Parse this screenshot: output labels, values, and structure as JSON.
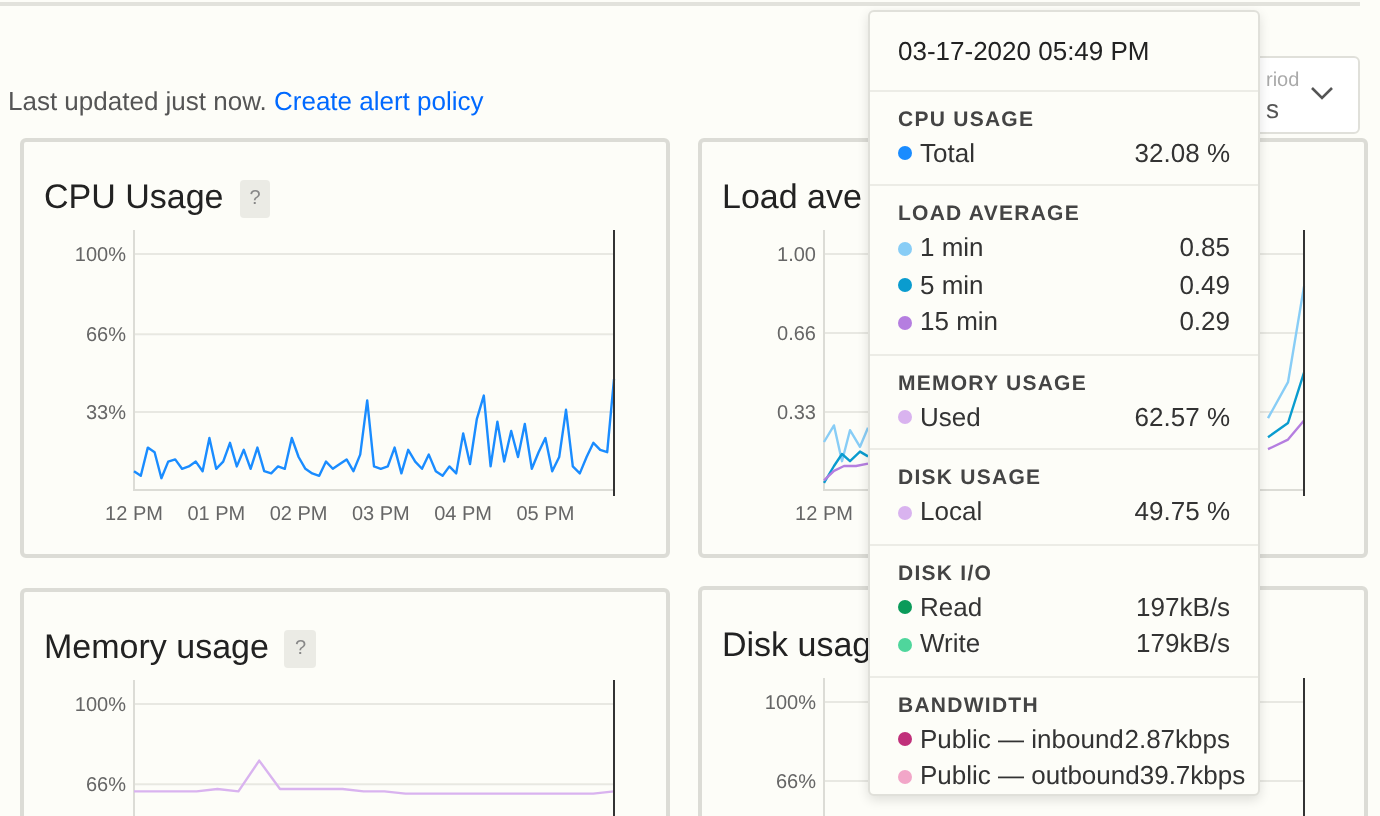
{
  "status": {
    "text": "Last updated just now.",
    "link": "Create alert policy"
  },
  "period_selector": {
    "label": "riod",
    "value": "s"
  },
  "cards": [
    {
      "title": "CPU Usage",
      "help": "?",
      "chart_data": {
        "type": "line",
        "ylim": [
          0,
          100
        ],
        "yticks": [
          {
            "value": 100,
            "label": "100%"
          },
          {
            "value": 66,
            "label": "66%"
          },
          {
            "value": 33,
            "label": "33%"
          }
        ],
        "categories": [
          "12 PM",
          null,
          null,
          null,
          null,
          null,
          null,
          null,
          null,
          null,
          null,
          null,
          "01 PM",
          null,
          null,
          null,
          null,
          null,
          null,
          null,
          null,
          null,
          null,
          null,
          "02 PM",
          null,
          null,
          null,
          null,
          null,
          null,
          null,
          null,
          null,
          null,
          null,
          "03 PM",
          null,
          null,
          null,
          null,
          null,
          null,
          null,
          null,
          null,
          null,
          null,
          "04 PM",
          null,
          null,
          null,
          null,
          null,
          null,
          null,
          null,
          null,
          null,
          null,
          "05 PM",
          null,
          null,
          null,
          null,
          null,
          null,
          null,
          null,
          null,
          null
        ],
        "series": [
          {
            "color": "#1a8cff",
            "values": [
              8,
              6,
              18,
              16,
              5,
              12,
              13,
              9,
              10,
              12,
              8,
              22,
              9,
              12,
              20,
              10,
              17,
              9,
              18,
              8,
              7,
              10,
              9,
              22,
              14,
              9,
              7,
              6,
              12,
              9,
              11,
              13,
              8,
              15,
              38,
              10,
              9,
              10,
              18,
              7,
              17,
              12,
              9,
              15,
              8,
              6,
              10,
              7,
              24,
              11,
              30,
              40,
              10,
              29,
              12,
              25,
              14,
              28,
              9,
              16,
              22,
              8,
              14,
              34,
              10,
              7,
              14,
              20,
              17,
              16,
              47
            ]
          }
        ]
      }
    },
    {
      "title": "Load ave",
      "axis": {
        "y_labels": [
          "1.00",
          "0.66",
          "0.33"
        ],
        "x_labels": [
          "12 PM"
        ],
        "kind": "load"
      }
    },
    {
      "title": "Memory usage",
      "help": "?",
      "chart_data": {
        "type": "line",
        "ylim": [
          0,
          100
        ],
        "yticks": [
          {
            "value": 100,
            "label": "100%"
          },
          {
            "value": 66,
            "label": "66%"
          }
        ],
        "categories": [
          null,
          null,
          null,
          null,
          null,
          null,
          null,
          null,
          null,
          null,
          null,
          null,
          null,
          null,
          null,
          null,
          null,
          null,
          null,
          null,
          null,
          null,
          null,
          null
        ],
        "series": [
          {
            "color": "#d9b3ef",
            "values": [
              63,
              63,
              63,
              63,
              64,
              63,
              76,
              64,
              64,
              64,
              64,
              63,
              63,
              62,
              62,
              62,
              62,
              62,
              62,
              62,
              62,
              62,
              62,
              63
            ]
          }
        ]
      }
    },
    {
      "title": "Disk usag",
      "axis": {
        "y_labels": [
          "100%",
          "66%"
        ],
        "kind": "empty"
      }
    }
  ],
  "tooltip": {
    "title": "03-17-2020 05:49 PM",
    "sections": [
      {
        "heading": "CPU USAGE",
        "rows": [
          {
            "label": "Total",
            "value": "32.08 %",
            "color": "#1a8cff"
          }
        ]
      },
      {
        "heading": "LOAD AVERAGE",
        "rows": [
          {
            "label": "1 min",
            "value": "0.85",
            "color": "#88cdf6"
          },
          {
            "label": "5 min",
            "value": "0.49",
            "color": "#0a9ccf"
          },
          {
            "label": "15 min",
            "value": "0.29",
            "color": "#b57ee0"
          }
        ]
      },
      {
        "heading": "MEMORY USAGE",
        "rows": [
          {
            "label": "Used",
            "value": "62.57 %",
            "color": "#d9b3ef"
          }
        ]
      },
      {
        "heading": "DISK USAGE",
        "rows": [
          {
            "label": "Local",
            "value": "49.75 %",
            "color": "#d9b3ef"
          }
        ]
      },
      {
        "heading": "DISK I/O",
        "rows": [
          {
            "label": "Read",
            "value": "197kB/s",
            "color": "#0b9b5a"
          },
          {
            "label": "Write",
            "value": "179kB/s",
            "color": "#4fd69c"
          }
        ]
      },
      {
        "heading": "BANDWIDTH",
        "rows": [
          {
            "label": "Public — inbound",
            "value": "2.87kbps",
            "color": "#c0307a"
          },
          {
            "label": "Public — outbound",
            "value": "39.7kbps",
            "color": "#f2a6c8"
          }
        ]
      }
    ]
  }
}
